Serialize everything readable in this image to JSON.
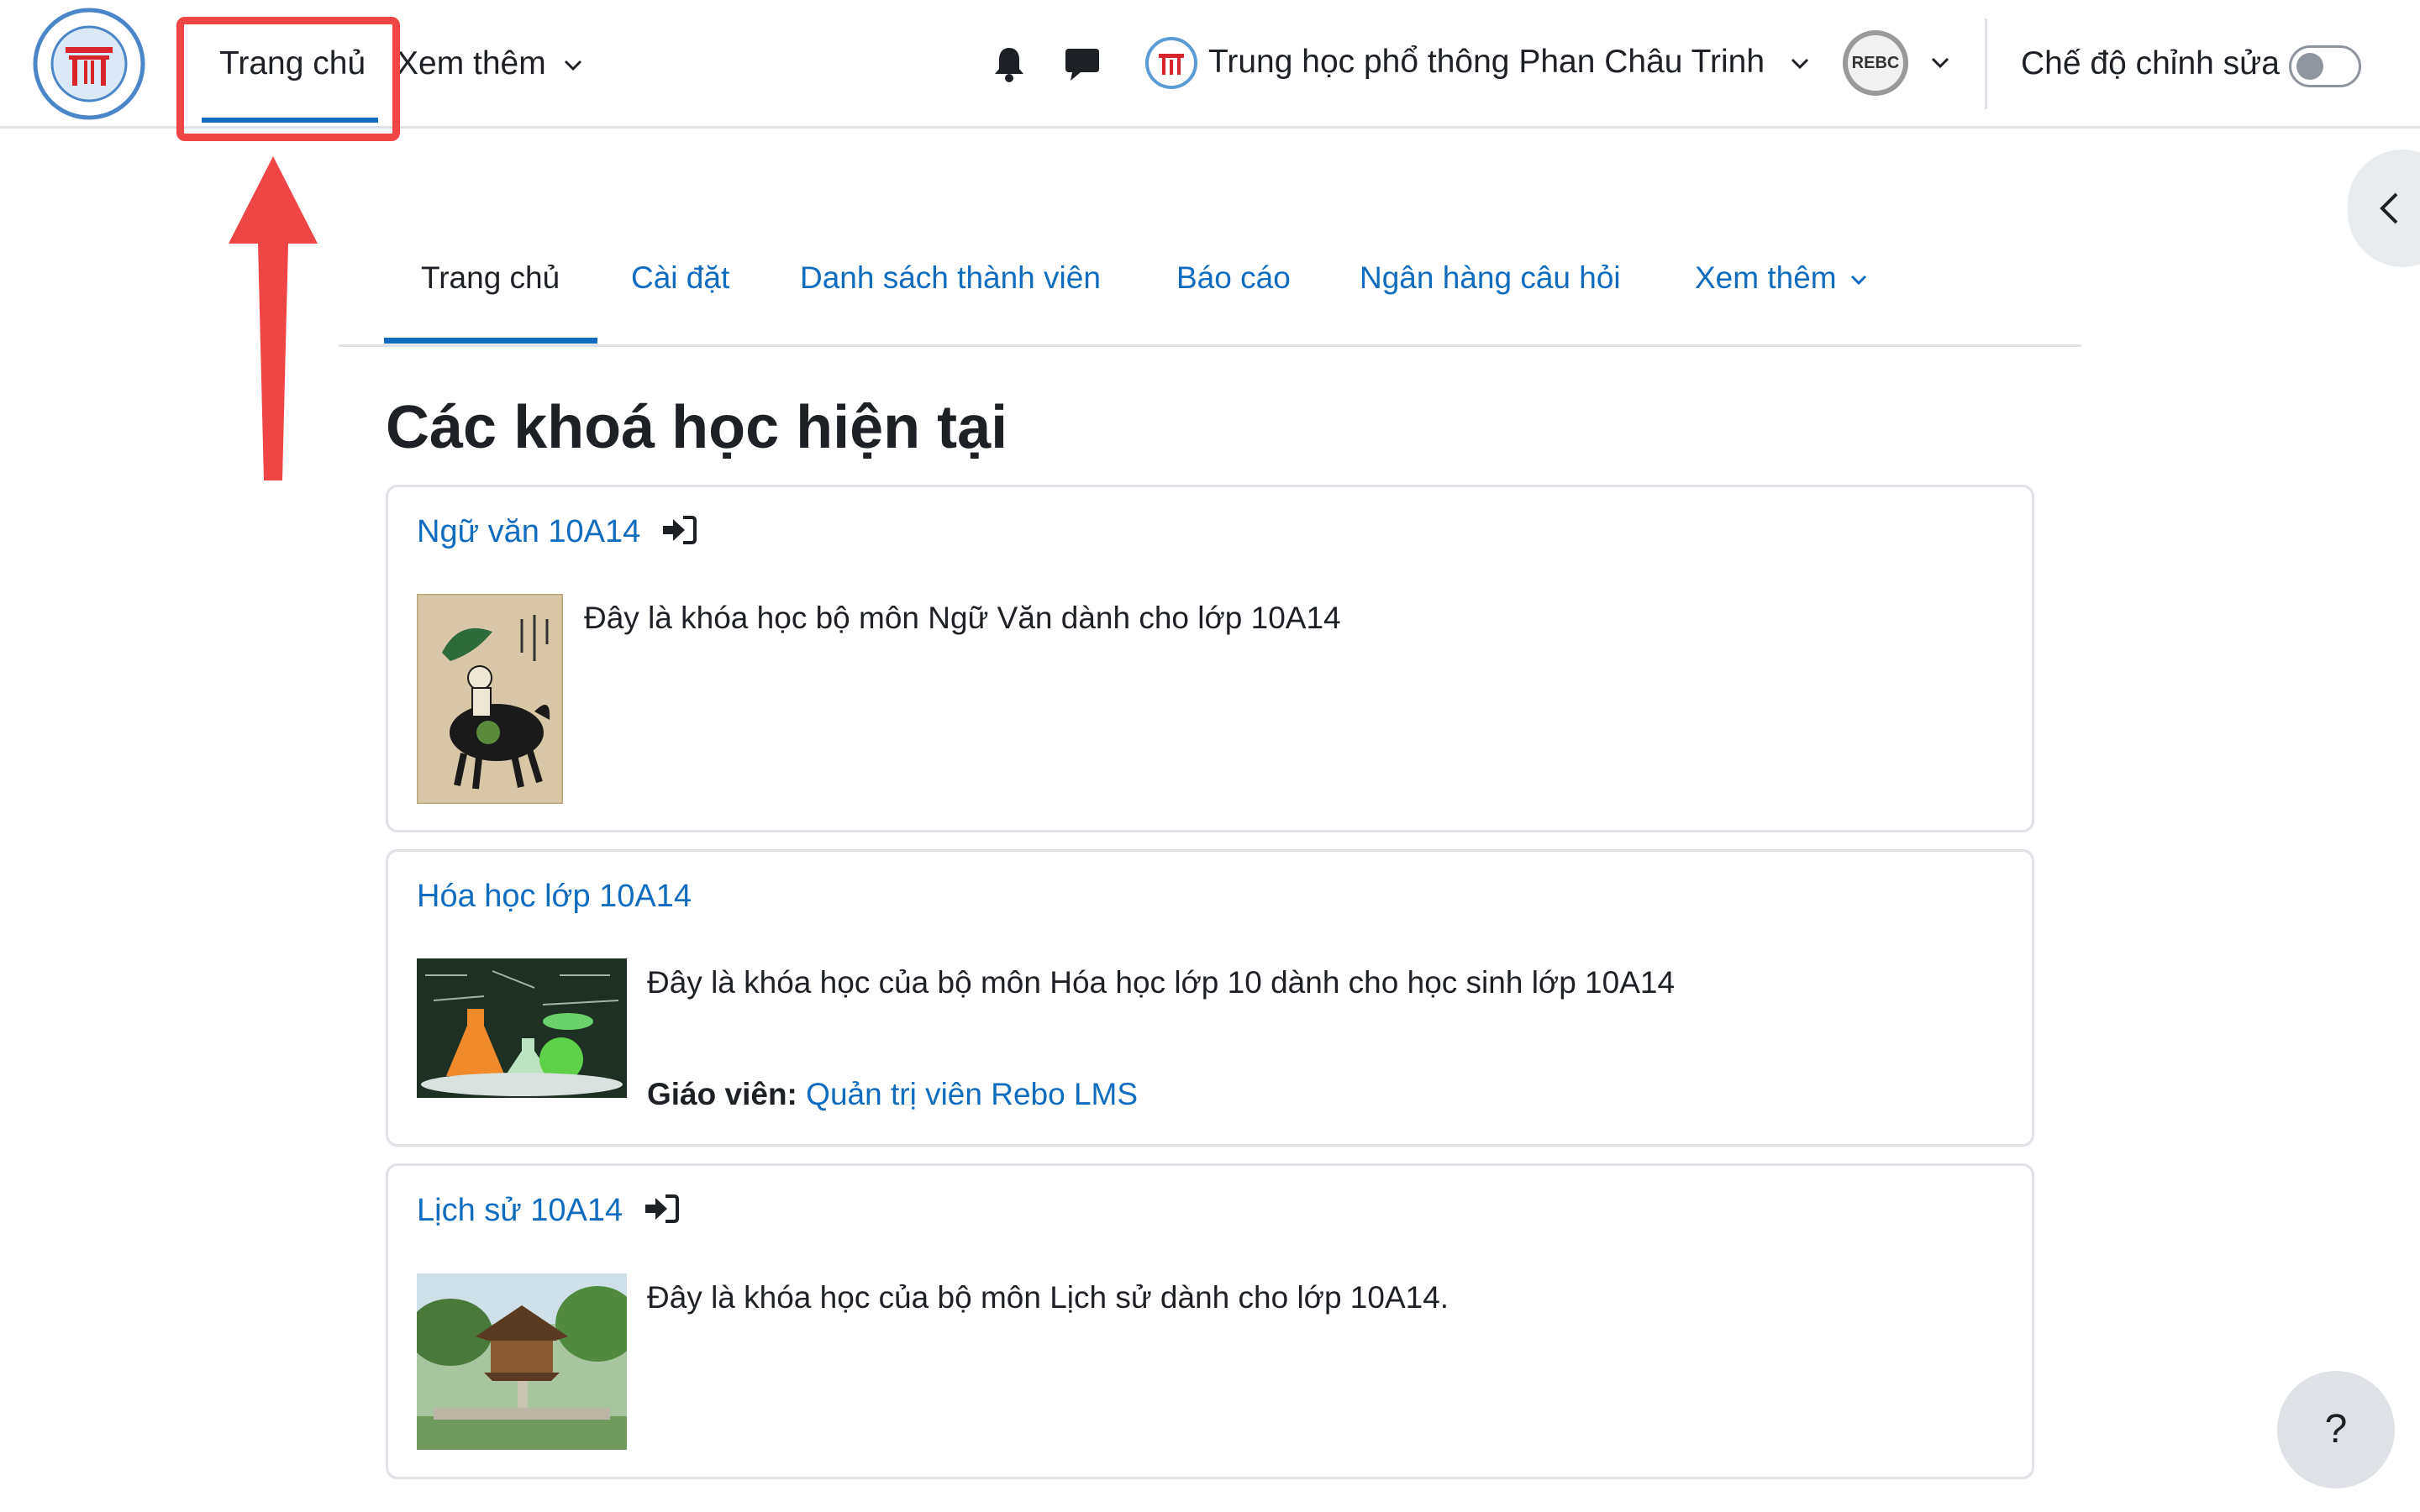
{
  "navbar": {
    "home_label": "Trang chủ",
    "more_label": "Xem thêm",
    "site_name": "Trung học phổ thông Phan Châu Trinh",
    "avatar_text": "REBC",
    "edit_mode_label": "Chế độ chỉnh sửa",
    "edit_mode_on": false
  },
  "secondary_nav": {
    "tabs": [
      {
        "label": "Trang chủ"
      },
      {
        "label": "Cài đặt"
      },
      {
        "label": "Danh sách thành viên"
      },
      {
        "label": "Báo cáo"
      },
      {
        "label": "Ngân hàng câu hỏi"
      },
      {
        "label": "Xem thêm"
      }
    ],
    "active_index": 0
  },
  "page_title": "Các khoá học hiện tại",
  "courses": [
    {
      "name": "Ngữ văn 10A14",
      "summary": "Đây là khóa học bộ môn Ngữ Văn dành cho lớp 10A14",
      "enrol_icon": "sign-in-icon"
    },
    {
      "name": "Hóa học lớp 10A14",
      "summary": "Đây là khóa học của bộ môn Hóa học lớp 10 dành cho học sinh lớp 10A14",
      "teacher_label": "Giáo viên:",
      "teacher_name": "Quản trị viên Rebo LMS"
    },
    {
      "name": "Lịch sử 10A14",
      "summary": "Đây là khóa học của bộ môn Lịch sử dành cho lớp 10A14.",
      "enrol_icon": "sign-in-icon"
    }
  ],
  "help_label": "?",
  "colors": {
    "link": "#0f6cbf",
    "highlight": "#f04545",
    "text": "#1d2125",
    "border": "#dee2e6"
  }
}
